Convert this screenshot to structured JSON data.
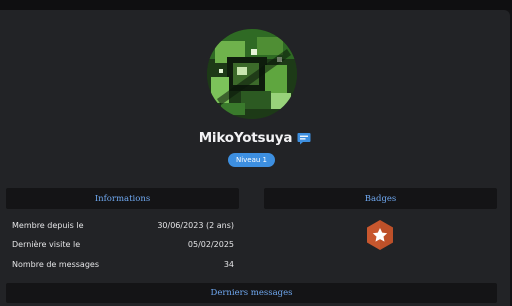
{
  "profile": {
    "username": "MikoYotsuya",
    "level_label": "Niveau 1",
    "message_icon": "chat-bubble-icon"
  },
  "sections": {
    "informations": "Informations",
    "badges": "Badges",
    "latest_messages": "Derniers messages"
  },
  "info": [
    {
      "label": "Membre depuis le",
      "value": "30/06/2023 (2 ans)"
    },
    {
      "label": "Dernière visite le",
      "value": "05/02/2025"
    },
    {
      "label": "Nombre de messages",
      "value": "34"
    }
  ],
  "badges": [
    {
      "icon": "star-hexagon-icon",
      "color": "#c8572e"
    }
  ],
  "colors": {
    "accent": "#3d8fe0",
    "section_title": "#6fa8f0",
    "badge": "#c8572e"
  }
}
